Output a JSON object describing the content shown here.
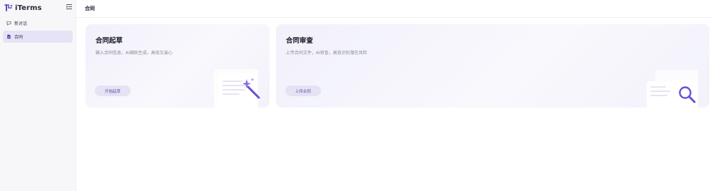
{
  "app": {
    "name": "iTerms"
  },
  "sidebar": {
    "items": [
      {
        "label": "新对话",
        "icon": "chat-icon",
        "active": false
      },
      {
        "label": "合同",
        "icon": "document-icon",
        "active": true
      }
    ]
  },
  "header": {
    "title": "合同"
  },
  "cards": [
    {
      "title": "合同起草",
      "description": "输入合同信息，AI辅助生成，高效又省心",
      "button": "开始起草",
      "illustration": "magic-wand-icon"
    },
    {
      "title": "合同审查",
      "description": "上传合同文件，AI审查，高效识别潜在风险",
      "button": "上传合同",
      "illustration": "magnifier-icon"
    }
  ],
  "colors": {
    "accent": "#7b5ce0",
    "active_bg": "#e6e3f6",
    "button_text": "#5a4ea8"
  }
}
